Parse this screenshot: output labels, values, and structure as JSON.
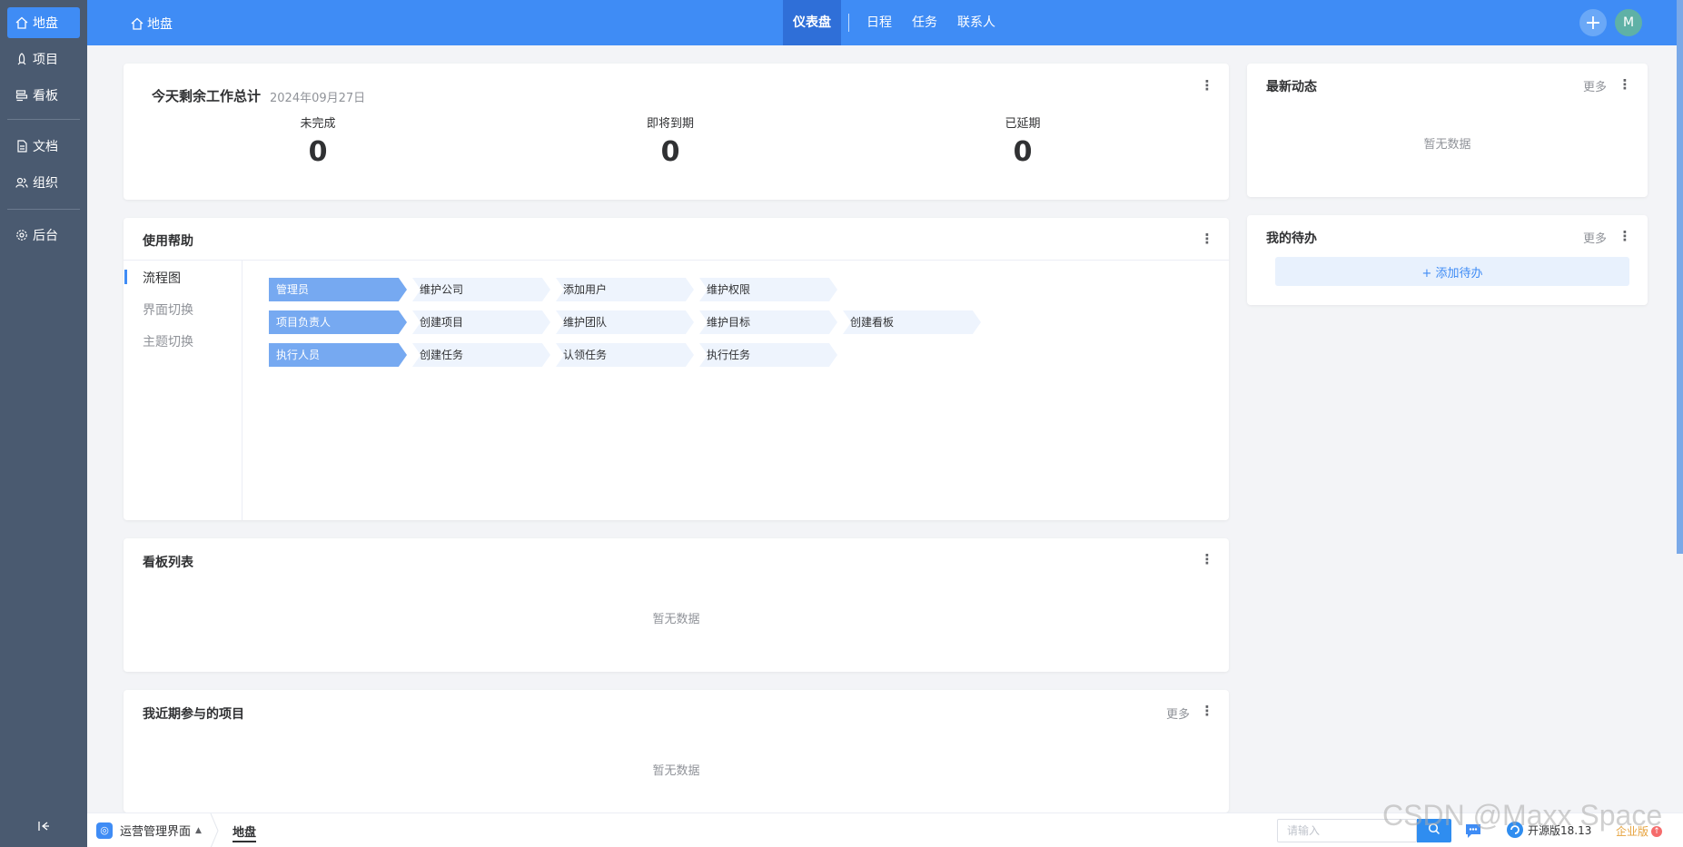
{
  "sidebar": {
    "items": [
      {
        "label": "地盘",
        "icon": "home-icon"
      },
      {
        "label": "项目",
        "icon": "rocket-icon"
      },
      {
        "label": "看板",
        "icon": "kanban-icon"
      },
      {
        "label": "文档",
        "icon": "document-icon"
      },
      {
        "label": "组织",
        "icon": "users-icon"
      },
      {
        "label": "后台",
        "icon": "gear-icon"
      }
    ],
    "collapse_icon": "collapse-left-icon"
  },
  "header": {
    "breadcrumb": "地盘",
    "nav": [
      "仪表盘",
      "日程",
      "任务",
      "联系人"
    ],
    "avatar": "M"
  },
  "summary": {
    "title": "今天剩余工作总计",
    "date": "2024年09月27日",
    "stats": [
      {
        "label": "未完成",
        "value": "0"
      },
      {
        "label": "即将到期",
        "value": "0"
      },
      {
        "label": "已延期",
        "value": "0"
      }
    ]
  },
  "help": {
    "title": "使用帮助",
    "tabs": [
      "流程图",
      "界面切换",
      "主题切换"
    ],
    "rows": [
      {
        "role": "管理员",
        "steps": [
          "维护公司",
          "添加用户",
          "维护权限"
        ]
      },
      {
        "role": "项目负责人",
        "steps": [
          "创建项目",
          "维护团队",
          "维护目标",
          "创建看板"
        ]
      },
      {
        "role": "执行人员",
        "steps": [
          "创建任务",
          "认领任务",
          "执行任务"
        ]
      }
    ]
  },
  "boards": {
    "title": "看板列表",
    "empty": "暂无数据"
  },
  "recent_projects": {
    "title": "我近期参与的项目",
    "more": "更多",
    "empty": "暂无数据"
  },
  "activity": {
    "title": "最新动态",
    "more": "更多",
    "empty": "暂无数据"
  },
  "todo": {
    "title": "我的待办",
    "more": "更多",
    "add_label": "+ 添加待办"
  },
  "footer": {
    "workspace": "运营管理界面",
    "tab": "地盘",
    "search_placeholder": "请输入",
    "version": "开源版18.13",
    "enterprise": "企业版"
  },
  "watermark": "CSDN @Maxx Space",
  "colors": {
    "primary": "#3f8cf5",
    "sidebar": "#4a5a70"
  }
}
